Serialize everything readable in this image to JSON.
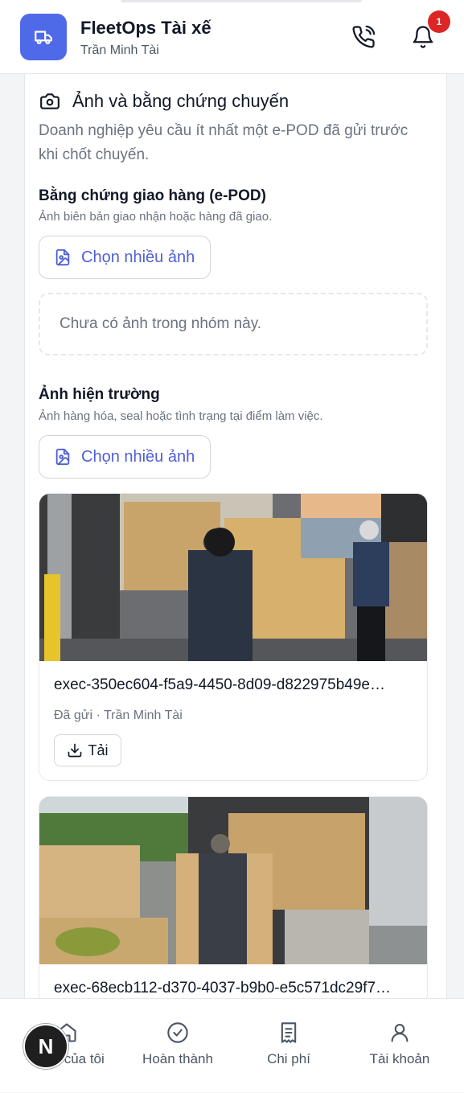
{
  "header": {
    "title": "FleetOps Tài xế",
    "subtitle": "Trần Minh Tài",
    "notification_count": "1",
    "icons": [
      "truck-icon",
      "phone-icon",
      "bell-icon"
    ]
  },
  "section": {
    "title": "Ảnh và bằng chứng chuyến",
    "description": "Doanh nghiệp yêu cầu ít nhất một e-POD đã gửi trước khi chốt chuyến."
  },
  "epod": {
    "title": "Bằng chứng giao hàng (e-POD)",
    "description": "Ảnh biên bản giao nhận hoặc hàng đã giao.",
    "button": "Chọn nhiều ảnh",
    "empty": "Chưa có ảnh trong nhóm này."
  },
  "scene": {
    "title": "Ảnh hiện trường",
    "description": "Ảnh hàng hóa, seal hoặc tình trạng tại điểm làm việc.",
    "button": "Chọn nhiều ảnh",
    "photos": [
      {
        "name": "exec-350ec604-f5a9-4450-8d09-d822975b49e…",
        "status": "Đã gửi",
        "by": "Trần Minh Tài",
        "download": "Tải"
      },
      {
        "name": "exec-68ecb112-d370-4037-b9b0-e5c571dc29f7…"
      }
    ]
  },
  "meta_separator": "·",
  "bottom_nav": [
    {
      "label": "Việc của tôi",
      "icon": "home-icon"
    },
    {
      "label": "Hoàn thành",
      "icon": "check-circle-icon"
    },
    {
      "label": "Chi phí",
      "icon": "receipt-icon"
    },
    {
      "label": "Tài khoản",
      "icon": "user-icon"
    }
  ],
  "fab": {
    "label": "N"
  },
  "colors": {
    "accent": "#4f6ae9",
    "link": "#4f5fd6",
    "badge": "#dc2626",
    "muted_text": "#6b7280"
  }
}
